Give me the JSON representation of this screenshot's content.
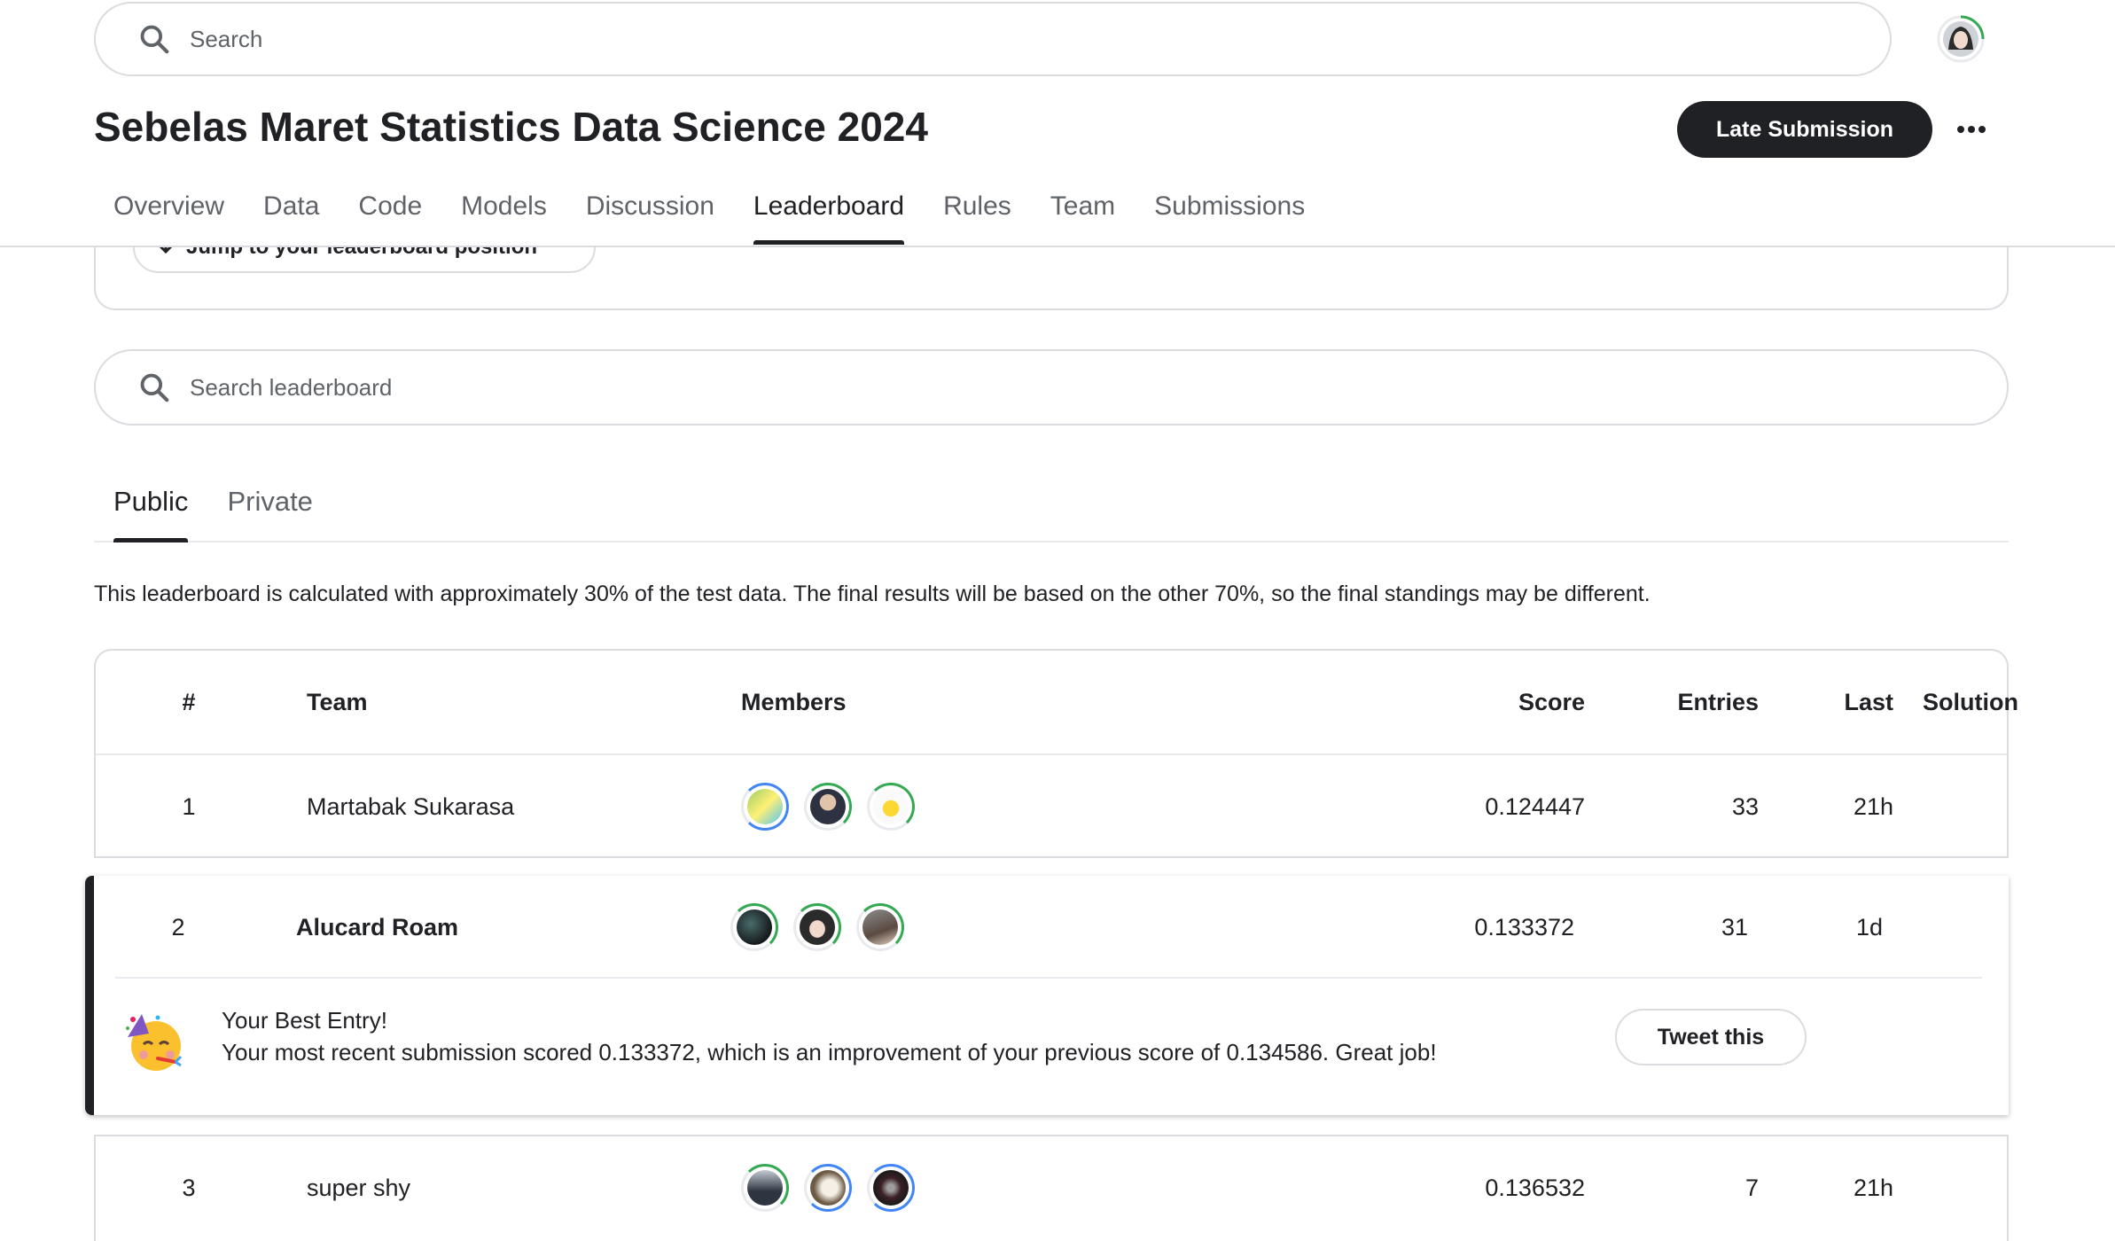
{
  "header": {
    "search_placeholder": "Search",
    "title": "Sebelas Maret Statistics Data Science 2024",
    "late_submission_label": "Late Submission",
    "tabs": [
      "Overview",
      "Data",
      "Code",
      "Models",
      "Discussion",
      "Leaderboard",
      "Rules",
      "Team",
      "Submissions"
    ],
    "active_tab": "Leaderboard"
  },
  "jump": {
    "label": "Jump to your leaderboard position"
  },
  "leaderboard": {
    "search_placeholder": "Search leaderboard",
    "tabs": [
      "Public",
      "Private"
    ],
    "active_tab": "Public",
    "notice": "This leaderboard is calculated with approximately 30% of the test data. The final results will be based on the other 70%, so the final standings may be different.",
    "columns": {
      "rank": "#",
      "team": "Team",
      "members": "Members",
      "score": "Score",
      "entries": "Entries",
      "last": "Last",
      "solution": "Solution"
    },
    "rows": [
      {
        "rank": "1",
        "team": "Martabak Sukarasa",
        "score": "0.124447",
        "entries": "33",
        "last": "21h"
      },
      {
        "rank": "2",
        "team": "Alucard Roam",
        "score": "0.133372",
        "entries": "31",
        "last": "1d"
      },
      {
        "rank": "3",
        "team": "super shy",
        "score": "0.136532",
        "entries": "7",
        "last": "21h"
      }
    ],
    "best_entry": {
      "title": "Your Best Entry!",
      "message": "Your most recent submission scored 0.133372, which is an improvement of your previous score of 0.134586. Great job!",
      "tweet_label": "Tweet this"
    }
  },
  "icons": [
    "search-icon",
    "more-icon",
    "arrow-down-icon",
    "party-face-icon"
  ],
  "colors": {
    "primary_button": "#202124",
    "progress_ring_green": "#34a853",
    "progress_ring_blue": "#4285f4",
    "border": "#dadce0"
  }
}
